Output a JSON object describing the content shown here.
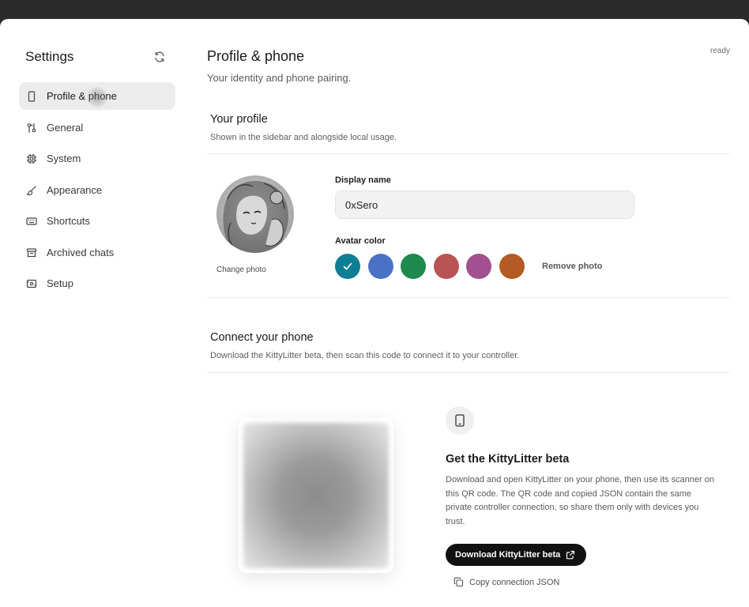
{
  "sidebar": {
    "title": "Settings",
    "items": [
      {
        "label": "Profile & phone",
        "icon": "phone-icon",
        "active": true
      },
      {
        "label": "General",
        "icon": "sliders-icon"
      },
      {
        "label": "System",
        "icon": "cpu-icon"
      },
      {
        "label": "Appearance",
        "icon": "brush-icon"
      },
      {
        "label": "Shortcuts",
        "icon": "keyboard-icon"
      },
      {
        "label": "Archived chats",
        "icon": "archive-icon"
      },
      {
        "label": "Setup",
        "icon": "setup-icon"
      }
    ]
  },
  "header": {
    "title": "Profile & phone",
    "subtitle": "Your identity and phone pairing.",
    "status": "ready"
  },
  "profile": {
    "title": "Your profile",
    "subtitle": "Shown in the sidebar and alongside local usage.",
    "change_photo": "Change photo",
    "display_name_label": "Display name",
    "display_name_value": "0xSero",
    "avatar_color_label": "Avatar color",
    "colors": [
      "#0e7e95",
      "#4a72c4",
      "#1e8a4d",
      "#b85554",
      "#a2508f",
      "#b45a25"
    ],
    "selected_color_index": 0,
    "remove_photo": "Remove photo"
  },
  "phone": {
    "title": "Connect your phone",
    "subtitle": "Download the KittyLitter beta, then scan this code to connect it to your controller.",
    "get_title": "Get the KittyLitter beta",
    "get_desc": "Download and open KittyLitter on your phone, then use its scanner on this QR code. The QR code and copied JSON contain the same private controller connection, so share them only with devices you trust.",
    "download_label": "Download KittyLitter beta",
    "copy_json_label": "Copy connection JSON"
  }
}
